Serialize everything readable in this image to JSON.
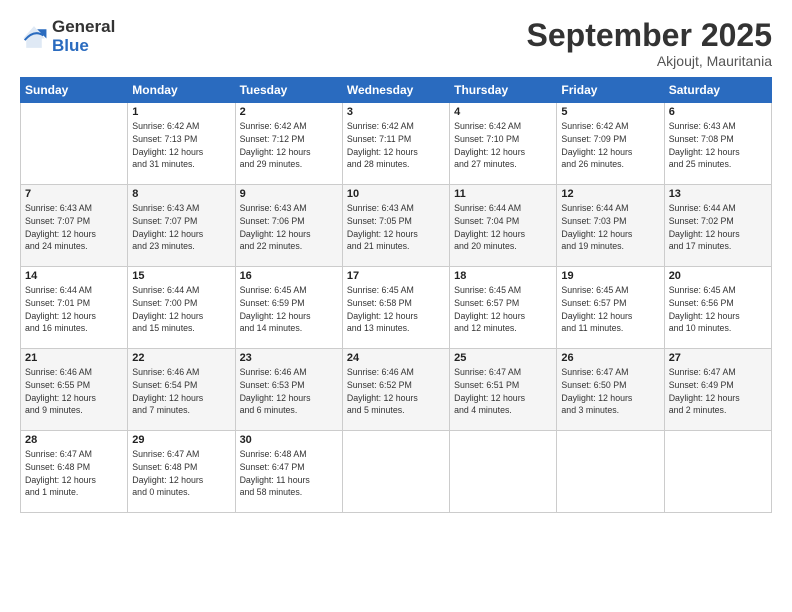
{
  "header": {
    "logo_general": "General",
    "logo_blue": "Blue",
    "month_title": "September 2025",
    "location": "Akjoujt, Mauritania"
  },
  "weekdays": [
    "Sunday",
    "Monday",
    "Tuesday",
    "Wednesday",
    "Thursday",
    "Friday",
    "Saturday"
  ],
  "weeks": [
    [
      {
        "day": "",
        "info": ""
      },
      {
        "day": "1",
        "info": "Sunrise: 6:42 AM\nSunset: 7:13 PM\nDaylight: 12 hours\nand 31 minutes."
      },
      {
        "day": "2",
        "info": "Sunrise: 6:42 AM\nSunset: 7:12 PM\nDaylight: 12 hours\nand 29 minutes."
      },
      {
        "day": "3",
        "info": "Sunrise: 6:42 AM\nSunset: 7:11 PM\nDaylight: 12 hours\nand 28 minutes."
      },
      {
        "day": "4",
        "info": "Sunrise: 6:42 AM\nSunset: 7:10 PM\nDaylight: 12 hours\nand 27 minutes."
      },
      {
        "day": "5",
        "info": "Sunrise: 6:42 AM\nSunset: 7:09 PM\nDaylight: 12 hours\nand 26 minutes."
      },
      {
        "day": "6",
        "info": "Sunrise: 6:43 AM\nSunset: 7:08 PM\nDaylight: 12 hours\nand 25 minutes."
      }
    ],
    [
      {
        "day": "7",
        "info": "Sunrise: 6:43 AM\nSunset: 7:07 PM\nDaylight: 12 hours\nand 24 minutes."
      },
      {
        "day": "8",
        "info": "Sunrise: 6:43 AM\nSunset: 7:07 PM\nDaylight: 12 hours\nand 23 minutes."
      },
      {
        "day": "9",
        "info": "Sunrise: 6:43 AM\nSunset: 7:06 PM\nDaylight: 12 hours\nand 22 minutes."
      },
      {
        "day": "10",
        "info": "Sunrise: 6:43 AM\nSunset: 7:05 PM\nDaylight: 12 hours\nand 21 minutes."
      },
      {
        "day": "11",
        "info": "Sunrise: 6:44 AM\nSunset: 7:04 PM\nDaylight: 12 hours\nand 20 minutes."
      },
      {
        "day": "12",
        "info": "Sunrise: 6:44 AM\nSunset: 7:03 PM\nDaylight: 12 hours\nand 19 minutes."
      },
      {
        "day": "13",
        "info": "Sunrise: 6:44 AM\nSunset: 7:02 PM\nDaylight: 12 hours\nand 17 minutes."
      }
    ],
    [
      {
        "day": "14",
        "info": "Sunrise: 6:44 AM\nSunset: 7:01 PM\nDaylight: 12 hours\nand 16 minutes."
      },
      {
        "day": "15",
        "info": "Sunrise: 6:44 AM\nSunset: 7:00 PM\nDaylight: 12 hours\nand 15 minutes."
      },
      {
        "day": "16",
        "info": "Sunrise: 6:45 AM\nSunset: 6:59 PM\nDaylight: 12 hours\nand 14 minutes."
      },
      {
        "day": "17",
        "info": "Sunrise: 6:45 AM\nSunset: 6:58 PM\nDaylight: 12 hours\nand 13 minutes."
      },
      {
        "day": "18",
        "info": "Sunrise: 6:45 AM\nSunset: 6:57 PM\nDaylight: 12 hours\nand 12 minutes."
      },
      {
        "day": "19",
        "info": "Sunrise: 6:45 AM\nSunset: 6:57 PM\nDaylight: 12 hours\nand 11 minutes."
      },
      {
        "day": "20",
        "info": "Sunrise: 6:45 AM\nSunset: 6:56 PM\nDaylight: 12 hours\nand 10 minutes."
      }
    ],
    [
      {
        "day": "21",
        "info": "Sunrise: 6:46 AM\nSunset: 6:55 PM\nDaylight: 12 hours\nand 9 minutes."
      },
      {
        "day": "22",
        "info": "Sunrise: 6:46 AM\nSunset: 6:54 PM\nDaylight: 12 hours\nand 7 minutes."
      },
      {
        "day": "23",
        "info": "Sunrise: 6:46 AM\nSunset: 6:53 PM\nDaylight: 12 hours\nand 6 minutes."
      },
      {
        "day": "24",
        "info": "Sunrise: 6:46 AM\nSunset: 6:52 PM\nDaylight: 12 hours\nand 5 minutes."
      },
      {
        "day": "25",
        "info": "Sunrise: 6:47 AM\nSunset: 6:51 PM\nDaylight: 12 hours\nand 4 minutes."
      },
      {
        "day": "26",
        "info": "Sunrise: 6:47 AM\nSunset: 6:50 PM\nDaylight: 12 hours\nand 3 minutes."
      },
      {
        "day": "27",
        "info": "Sunrise: 6:47 AM\nSunset: 6:49 PM\nDaylight: 12 hours\nand 2 minutes."
      }
    ],
    [
      {
        "day": "28",
        "info": "Sunrise: 6:47 AM\nSunset: 6:48 PM\nDaylight: 12 hours\nand 1 minute."
      },
      {
        "day": "29",
        "info": "Sunrise: 6:47 AM\nSunset: 6:48 PM\nDaylight: 12 hours\nand 0 minutes."
      },
      {
        "day": "30",
        "info": "Sunrise: 6:48 AM\nSunset: 6:47 PM\nDaylight: 11 hours\nand 58 minutes."
      },
      {
        "day": "",
        "info": ""
      },
      {
        "day": "",
        "info": ""
      },
      {
        "day": "",
        "info": ""
      },
      {
        "day": "",
        "info": ""
      }
    ]
  ]
}
